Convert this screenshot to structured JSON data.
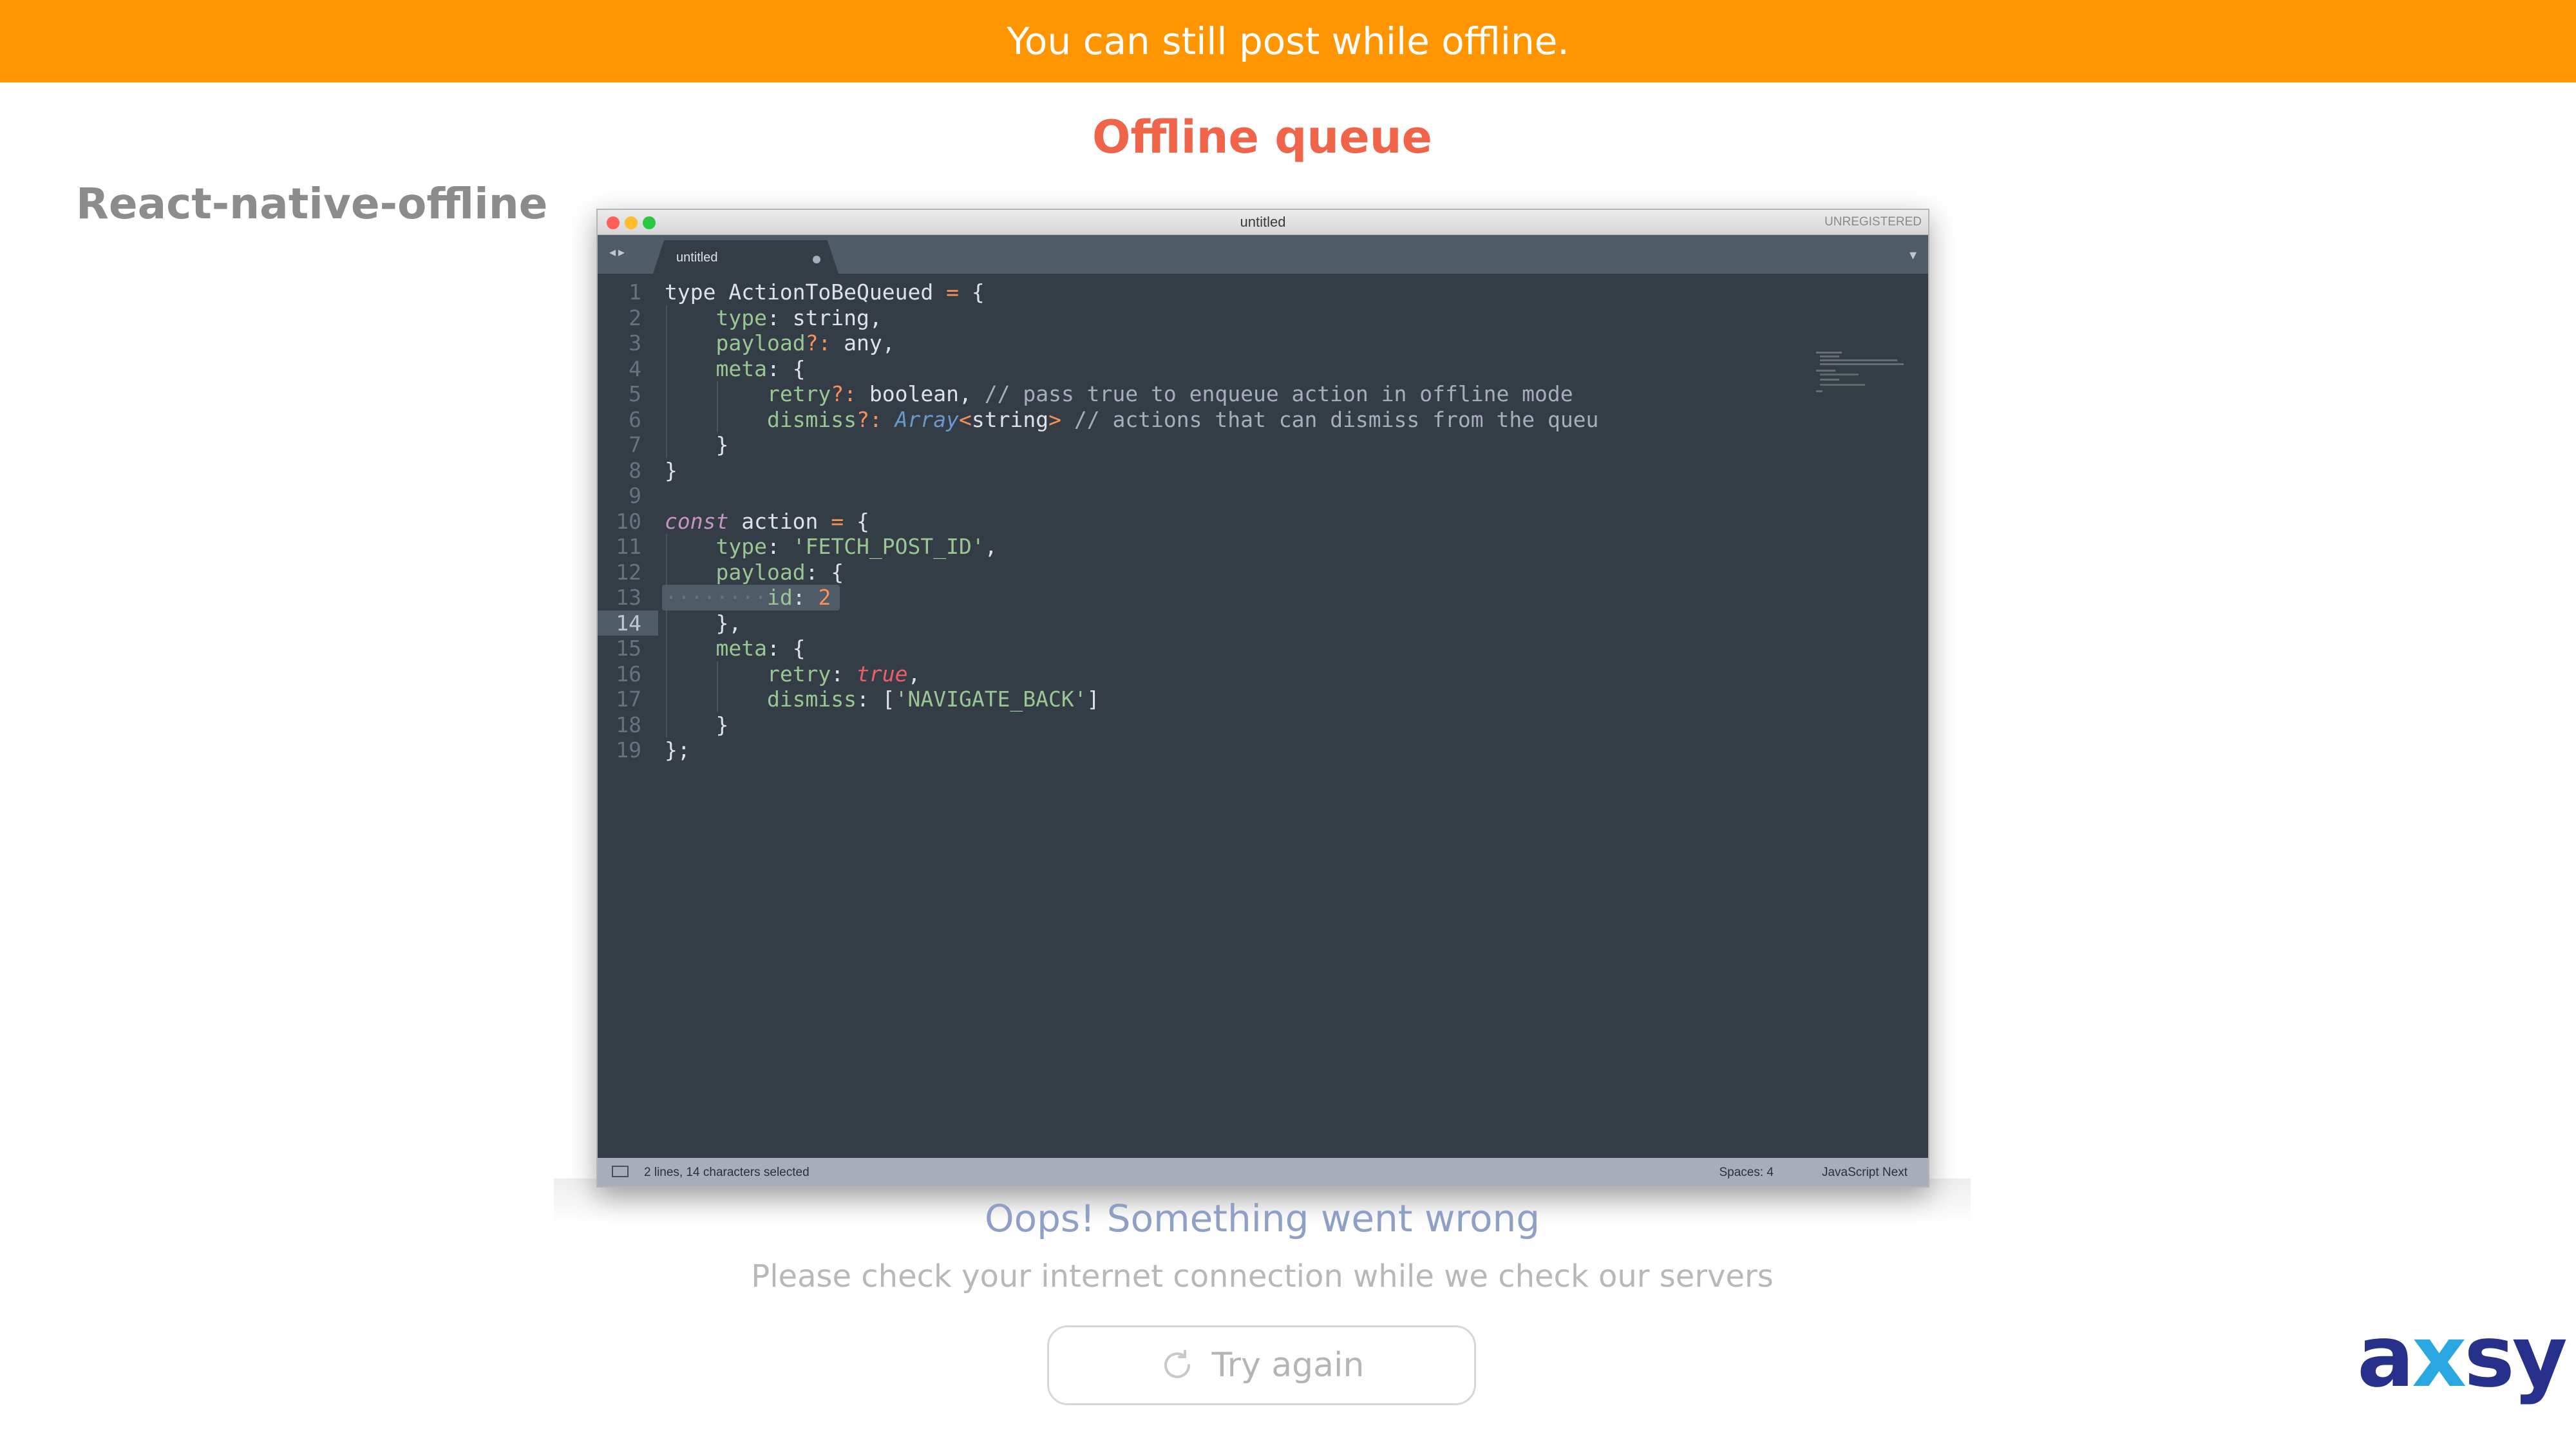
{
  "banner": {
    "text": "You can still post while offline."
  },
  "slide": {
    "title": "Offline queue",
    "side_title": "React-native-offline"
  },
  "window": {
    "title": "untitled",
    "registration": "UNREGISTERED",
    "tab_label": "untitled",
    "traffic_lights": {
      "close": "#ff5f57",
      "minimize": "#febc2e",
      "zoom": "#28c840"
    }
  },
  "editor": {
    "current_line": 14,
    "line_numbers": [
      "1",
      "2",
      "3",
      "4",
      "5",
      "6",
      "7",
      "8",
      "9",
      "10",
      "11",
      "12",
      "13",
      "14",
      "15",
      "16",
      "17",
      "18",
      "19"
    ],
    "lines": [
      [
        {
          "t": "type ActionToBeQueued ",
          "c": ""
        },
        {
          "t": "=",
          "c": "o"
        },
        {
          "t": " {",
          "c": ""
        }
      ],
      [
        {
          "t": "    ",
          "c": ""
        },
        {
          "t": "type",
          "c": "p"
        },
        {
          "t": ": string,",
          "c": ""
        }
      ],
      [
        {
          "t": "    ",
          "c": ""
        },
        {
          "t": "payload",
          "c": "p"
        },
        {
          "t": "?:",
          "c": "o"
        },
        {
          "t": " any,",
          "c": ""
        }
      ],
      [
        {
          "t": "    ",
          "c": ""
        },
        {
          "t": "meta",
          "c": "p"
        },
        {
          "t": ": {",
          "c": ""
        }
      ],
      [
        {
          "t": "        ",
          "c": ""
        },
        {
          "t": "retry",
          "c": "p"
        },
        {
          "t": "?:",
          "c": "o"
        },
        {
          "t": " boolean, ",
          "c": ""
        },
        {
          "t": "// pass true to enqueue action in offline mode",
          "c": "c"
        }
      ],
      [
        {
          "t": "        ",
          "c": ""
        },
        {
          "t": "dismiss",
          "c": "p"
        },
        {
          "t": "?:",
          "c": "o"
        },
        {
          "t": " ",
          "c": ""
        },
        {
          "t": "Array",
          "c": "t"
        },
        {
          "t": "<",
          "c": "o"
        },
        {
          "t": "string",
          "c": ""
        },
        {
          "t": ">",
          "c": "o"
        },
        {
          "t": " ",
          "c": ""
        },
        {
          "t": "// actions that can dismiss from the queu",
          "c": "c"
        }
      ],
      [
        {
          "t": "    }",
          "c": ""
        }
      ],
      [
        {
          "t": "}",
          "c": ""
        }
      ],
      [],
      [
        {
          "t": "const",
          "c": "k"
        },
        {
          "t": " action ",
          "c": ""
        },
        {
          "t": "=",
          "c": "o"
        },
        {
          "t": " {",
          "c": ""
        }
      ],
      [
        {
          "t": "    ",
          "c": ""
        },
        {
          "t": "type",
          "c": "p"
        },
        {
          "t": ": ",
          "c": ""
        },
        {
          "t": "'FETCH_POST_ID'",
          "c": "s"
        },
        {
          "t": ",",
          "c": ""
        }
      ],
      [
        {
          "t": "    ",
          "c": ""
        },
        {
          "t": "payload",
          "c": "p"
        },
        {
          "t": ": {",
          "c": ""
        }
      ],
      [
        {
          "t": "········",
          "c": "dim"
        },
        {
          "t": "id",
          "c": "p"
        },
        {
          "t": ": ",
          "c": ""
        },
        {
          "t": "2",
          "c": "n"
        }
      ],
      [
        {
          "t": "    },",
          "c": ""
        }
      ],
      [
        {
          "t": "    ",
          "c": ""
        },
        {
          "t": "meta",
          "c": "p"
        },
        {
          "t": ": {",
          "c": ""
        }
      ],
      [
        {
          "t": "        ",
          "c": ""
        },
        {
          "t": "retry",
          "c": "p"
        },
        {
          "t": ": ",
          "c": ""
        },
        {
          "t": "true",
          "c": "b"
        },
        {
          "t": ",",
          "c": ""
        }
      ],
      [
        {
          "t": "        ",
          "c": ""
        },
        {
          "t": "dismiss",
          "c": "p"
        },
        {
          "t": ": [",
          "c": ""
        },
        {
          "t": "'NAVIGATE_BACK'",
          "c": "s"
        },
        {
          "t": "]",
          "c": ""
        }
      ],
      [
        {
          "t": "    }",
          "c": ""
        }
      ],
      [
        {
          "t": "};",
          "c": ""
        }
      ]
    ]
  },
  "statusbar": {
    "selection": "2 lines, 14 characters selected",
    "spaces": "Spaces: 4",
    "syntax": "JavaScript Next"
  },
  "error": {
    "title": "Oops! Something went wrong",
    "subtitle": "Please check your internet connection while we check our servers",
    "retry_label": "Try again"
  },
  "logo": {
    "prefix": "a",
    "accent": "x",
    "suffix": "sy",
    "brand_color": "#27318b",
    "accent_color": "#2aa7e0"
  },
  "colors": {
    "banner": "#ff9500",
    "title": "#f0644a",
    "editor_bg": "#343d46"
  }
}
